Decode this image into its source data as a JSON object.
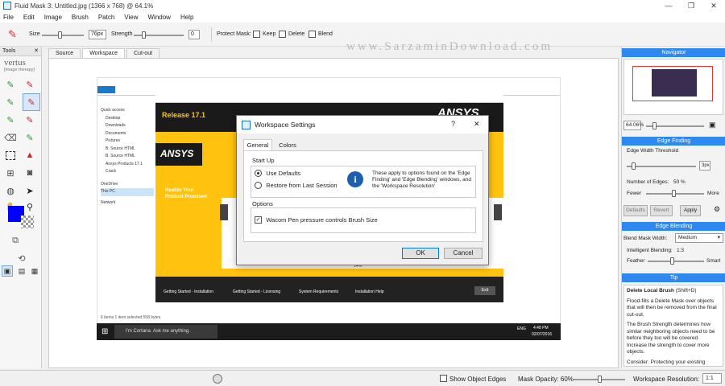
{
  "window": {
    "title": "Fluid Mask 3: Untitled.jpg (1366 x 768) @ 64.1%",
    "controls": [
      "—",
      "❐",
      "✕"
    ]
  },
  "menu": [
    "File",
    "Edit",
    "Image",
    "Brush",
    "Patch",
    "View",
    "Window",
    "Help"
  ],
  "toolbar": {
    "size_label": "Size",
    "size_value": "76px",
    "strength_label": "Strength",
    "strength_value": "0",
    "protect_mask_label": "Protect Mask:",
    "keep_label": "Keep",
    "delete_label": "Delete",
    "blend_label": "Blend"
  },
  "watermark": "www.SarzaminDownload.com",
  "tools_panel": {
    "header": "Tools",
    "logo": "vertus",
    "logo_sub": "[image therapy]"
  },
  "tabs": [
    "Source",
    "Workspace",
    "Cut-out"
  ],
  "screenshot": {
    "ansys_logo": "ANSYS",
    "release": "Release 17.1",
    "tagline_1": "Realize Your",
    "tagline_2": "Product Promise®",
    "percent": "14%",
    "bottom_links": [
      "Getting Started - Installation",
      "Getting Started - Licensing",
      "System Requirements",
      "Installation Help"
    ],
    "exit_label": "Exit",
    "explorer_items": [
      "Quick access",
      "Desktop",
      "Downloads",
      "Documents",
      "Pictures",
      "B. Source HTML",
      "B. Source HTML",
      "Ansys Products 17.1",
      "Crack",
      "OneDrive",
      "This PC",
      "Network"
    ],
    "explorer_status": "6 items   1 item selected   558 bytes",
    "taskbar_search": "I'm Cortana. Ask me anything.",
    "taskbar_time": "4:48 PM",
    "taskbar_date": "02/07/2016",
    "taskbar_lang": "ENG"
  },
  "dialog": {
    "title": "Workspace Settings",
    "help": "?",
    "close": "✕",
    "tabs": [
      "General",
      "Colors"
    ],
    "startup_label": "Start Up",
    "use_defaults": "Use Defaults",
    "restore": "Restore from Last Session",
    "info_text": "These apply to options found on the 'Edge Finding' and 'Edge Blending' windows, and the 'Workspace Resolution'",
    "options_label": "Options",
    "wacom_label": "Wacom Pen pressure controls Brush Size",
    "ok": "OK",
    "cancel": "Cancel"
  },
  "navigator": {
    "header": "Navigator",
    "zoom": "64.06%"
  },
  "edge_finding": {
    "header": "Edge Finding",
    "threshold_label": "Edge Width Threshold",
    "threshold_value": "3px",
    "edges_label": "Number of Edges:",
    "edges_value": "50 %",
    "fewer": "Fewer",
    "more": "More",
    "defaults": "Defaults",
    "revert": "Revert",
    "apply": "Apply"
  },
  "edge_blending": {
    "header": "Edge Blending",
    "blend_width_label": "Blend Mask Width:",
    "blend_width_value": "Medium",
    "intelligent_label": "Intelligent Blending:",
    "intelligent_value": "1:3",
    "feather": "Feather",
    "smart": "Smart"
  },
  "tip": {
    "header": "Tip",
    "title": "Delete Local Brush",
    "shortcut": "(Shift+D)",
    "p1": "Flood-fills a Delete Mask over objects that will then be removed from the final cut-out.",
    "p2": "The Brush Strength determines how similar neighboring objects need to be before they too will be covered. Increase the strength to cover more objects.",
    "p3": "Consider: Protecting your existing masks by checking Protect Mask."
  },
  "status": {
    "show_edges": "Show Object Edges",
    "mask_opacity": "Mask Opacity: 60%",
    "resolution_label": "Workspace Resolution:",
    "resolution_value": "1:1"
  },
  "colors": {
    "accent": "#2d89ef",
    "ansys_yellow": "#ffc20e",
    "brush_color": "#0000ff"
  }
}
